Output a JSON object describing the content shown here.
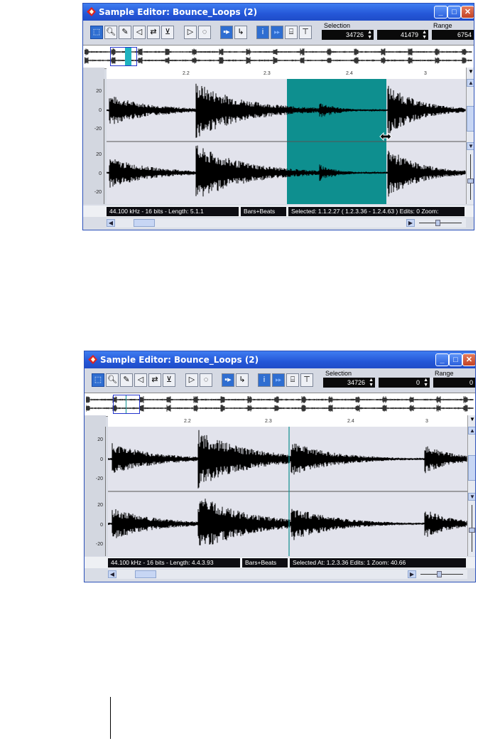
{
  "windows": [
    {
      "title": "Sample Editor: Bounce_Loops (2)",
      "selection_label": "Selection",
      "range_label": "Range",
      "selection_start": "34726",
      "selection_end": "41479",
      "range_value": "6754",
      "ruler_ticks": [
        "2.2",
        "2.3",
        "2.4",
        "3"
      ],
      "amp_labels": [
        "20",
        "0",
        "-20",
        "20",
        "0",
        "-20"
      ],
      "status": {
        "format": "44.100 kHz - 16 bits - Length: 5.1.1",
        "units": "Bars+Beats",
        "info": "Selected: 1.1.2.27 ( 1.2.3.36 - 1.2.4.63 )  Edits: 0   Zoom:"
      }
    },
    {
      "title": "Sample Editor: Bounce_Loops (2)",
      "selection_label": "Selection",
      "range_label": "Range",
      "selection_start": "34726",
      "selection_end": "0",
      "range_value": "0",
      "ruler_ticks": [
        "2.2",
        "2.3",
        "2.4",
        "3"
      ],
      "amp_labels": [
        "20",
        "0",
        "-20",
        "20",
        "0",
        "-20"
      ],
      "status": {
        "format": "44.100 kHz - 16 bits - Length: 4.4.3.93",
        "units": "Bars+Beats",
        "info": "Selected At: 1.2.3.36     Edits: 1     Zoom: 40.66"
      }
    }
  ],
  "colors": {
    "title_bar": "#2457d8",
    "selection_fill": "#0e8f8f",
    "waveform": "#000000",
    "wave_bg": "#e2e3ec"
  },
  "icons": [
    "sample-editor-icon",
    "object-selection-tool-icon",
    "zoom-tool-icon",
    "pencil-tool-icon",
    "play-tool-icon",
    "scrub-tool-icon",
    "snap-icon",
    "info-icon",
    "loop-icon",
    "hitpoint-icon",
    "minimize-icon",
    "maximize-icon",
    "close-icon",
    "resize-cursor-icon"
  ]
}
